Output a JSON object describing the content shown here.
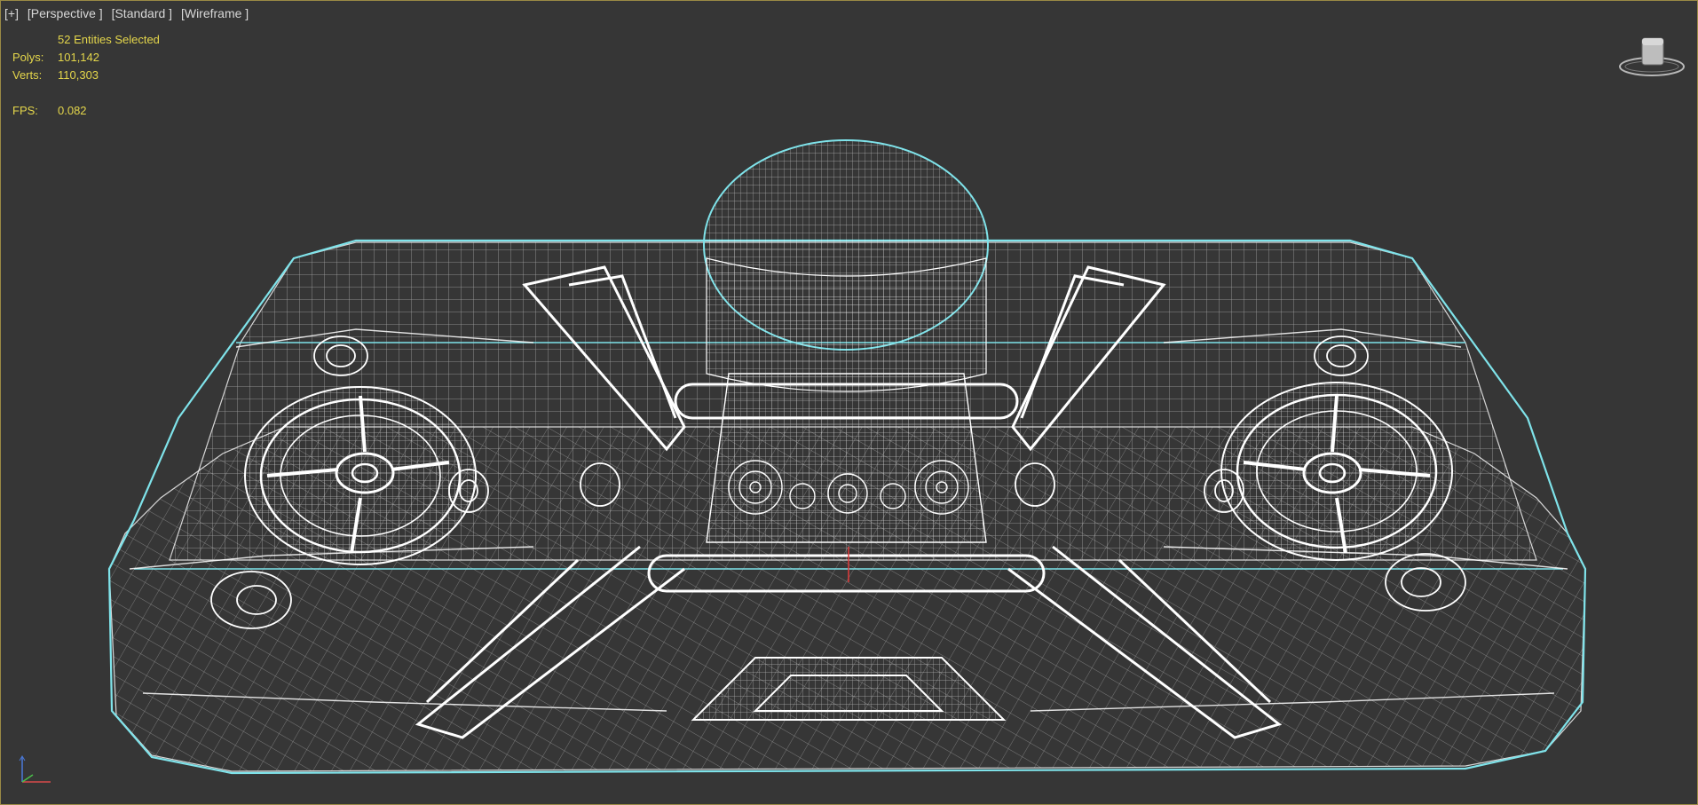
{
  "viewport": {
    "labels": [
      "[+]",
      "[Perspective ]",
      "[Standard ]",
      "[Wireframe ]"
    ]
  },
  "stats": {
    "selected": "52 Entities Selected",
    "polys_label": "Polys:",
    "polys_value": "101,142",
    "verts_label": "Verts:",
    "verts_value": "110,303",
    "fps_label": "FPS:",
    "fps_value": "0.082"
  },
  "colors": {
    "background": "#363636",
    "stats_text": "#e4d64b",
    "selection_outline": "#7fe3ea",
    "wireframe": "#ffffff"
  },
  "icons": {
    "viewcube": "viewcube-icon",
    "axis_gizmo": "axis-tripod-icon"
  }
}
